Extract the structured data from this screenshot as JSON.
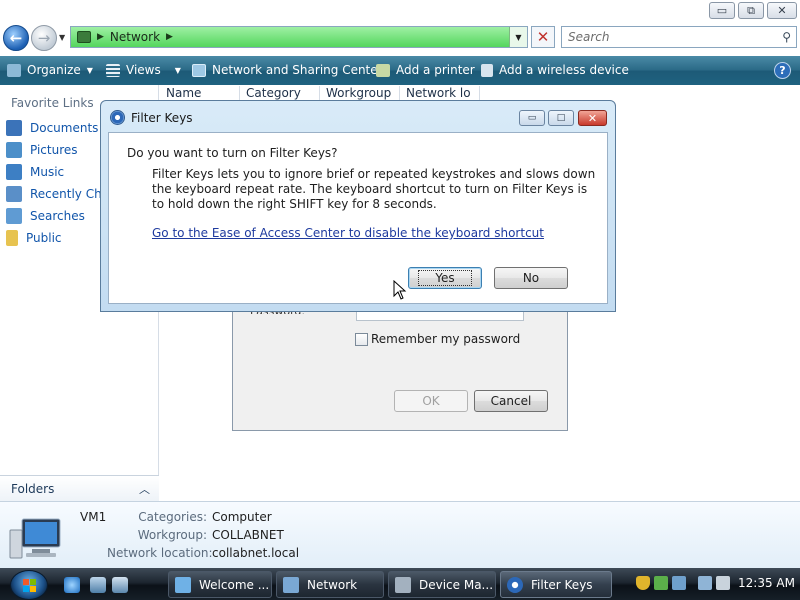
{
  "window_controls": {
    "minimize": "▭",
    "maximize": "⧉",
    "close": "✕"
  },
  "address_bar": {
    "breadcrumb": "Network",
    "search_placeholder": "Search"
  },
  "command_bar": {
    "organize": "Organize",
    "views": "Views",
    "network_sharing_center": "Network and Sharing Center",
    "add_printer": "Add a printer",
    "add_wireless": "Add a wireless device",
    "help": "?"
  },
  "nav_pane": {
    "favorite_links_title": "Favorite Links",
    "items": [
      {
        "label": "Documents",
        "icon": "documents-icon",
        "color": "#3b73b9"
      },
      {
        "label": "Pictures",
        "icon": "pictures-icon",
        "color": "#4c8fc9"
      },
      {
        "label": "Music",
        "icon": "music-icon",
        "color": "#3d7fc4"
      },
      {
        "label": "Recently Changed",
        "icon": "recent-icon",
        "color": "#5a8fc8"
      },
      {
        "label": "Searches",
        "icon": "searches-icon",
        "color": "#5f9bd3"
      },
      {
        "label": "Public",
        "icon": "folder-icon",
        "color": "#e7c350"
      }
    ],
    "folders_label": "Folders"
  },
  "columns": [
    "Name",
    "Category",
    "Workgroup",
    "Network lo"
  ],
  "login_dialog": {
    "password_label": "Password:",
    "remember_label": "Remember my password",
    "ok_label": "OK",
    "cancel_label": "Cancel"
  },
  "filter_keys_dialog": {
    "title": "Filter Keys",
    "question": "Do you want to turn on Filter Keys?",
    "description": "Filter Keys lets you to ignore brief or repeated keystrokes and slows down the keyboard repeat rate.  The keyboard shortcut to turn on Filter Keys is to hold down the right SHIFT key for 8 seconds.",
    "link": "Go to the Ease of Access Center to disable the keyboard shortcut",
    "yes_label": "Yes",
    "no_label": "No"
  },
  "details_pane": {
    "computer_name": "VM1",
    "rows": [
      {
        "label": "Categories:",
        "value": "Computer"
      },
      {
        "label": "Workgroup:",
        "value": "COLLABNET"
      },
      {
        "label": "Network location:",
        "value": "collabnet.local"
      }
    ]
  },
  "taskbar": {
    "tasks": [
      {
        "label": "Welcome ...",
        "icon": "welcome-icon",
        "active": false
      },
      {
        "label": "Network",
        "icon": "network-icon",
        "active": false
      },
      {
        "label": "Device Ma...",
        "icon": "device-manager-icon",
        "active": false
      },
      {
        "label": "Filter Keys",
        "icon": "filter-keys-icon",
        "active": true
      }
    ],
    "clock": "12:35 AM"
  },
  "colors": {
    "command_bar": "#2b6a87",
    "address_bar": "#54d65d",
    "link": "#1155aa",
    "taskbar": "#1d2630"
  }
}
